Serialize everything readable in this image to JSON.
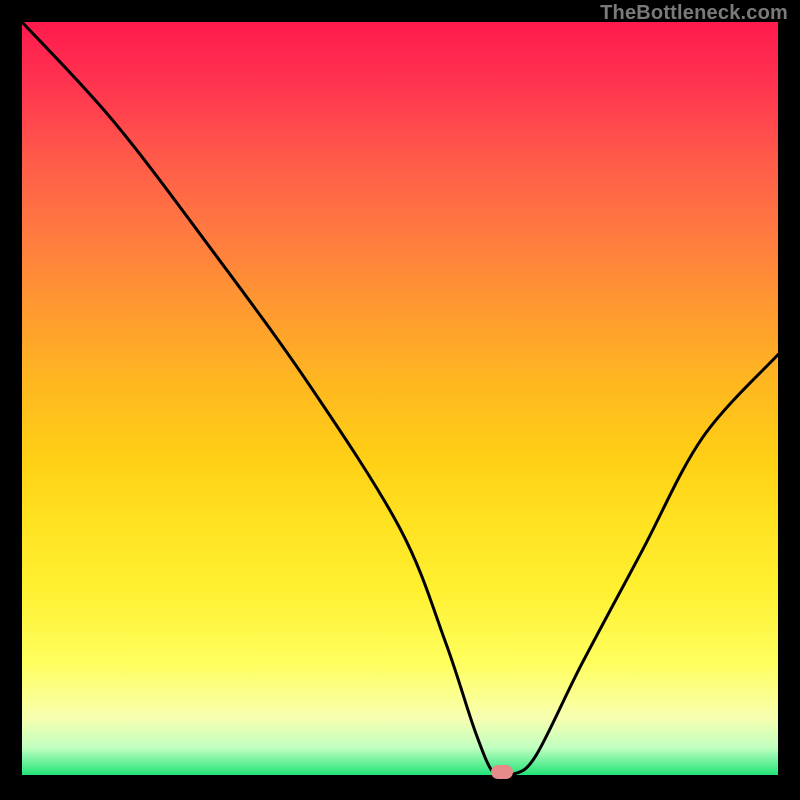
{
  "watermark": "TheBottleneck.com",
  "chart_data": {
    "type": "line",
    "title": "",
    "xlabel": "",
    "ylabel": "",
    "xlim": [
      0,
      100
    ],
    "ylim": [
      0,
      100
    ],
    "x": [
      0,
      12,
      25,
      38,
      50,
      56,
      60,
      62.5,
      65,
      68,
      74,
      82,
      90,
      100
    ],
    "values": [
      100,
      87,
      70,
      52,
      33,
      18,
      6,
      0.5,
      0.5,
      3,
      15,
      30,
      45,
      56
    ],
    "minimum_x": 63,
    "marker": {
      "x": 63.5,
      "y": 0.8
    },
    "gradient_stops": [
      {
        "pos": 0.0,
        "color": "#ff1a4d"
      },
      {
        "pos": 0.5,
        "color": "#ffc518"
      },
      {
        "pos": 0.8,
        "color": "#fff040"
      },
      {
        "pos": 0.96,
        "color": "#c0ffc0"
      },
      {
        "pos": 1.0,
        "color": "#10e070"
      }
    ]
  }
}
